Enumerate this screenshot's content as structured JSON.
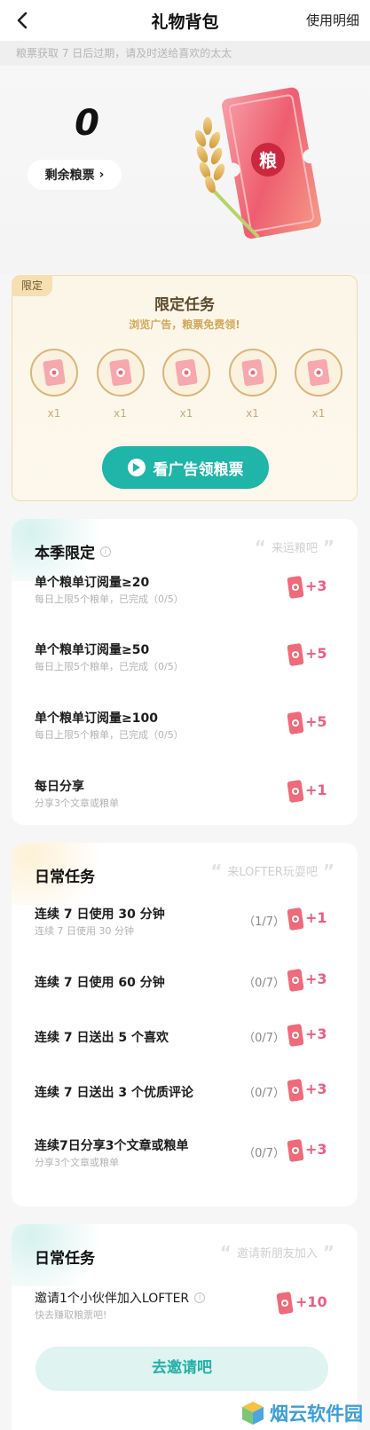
{
  "header": {
    "title": "礼物背包",
    "detail_link": "使用明细"
  },
  "notice": "粮票获取 7 日后过期，请及时送给喜欢的太太",
  "balance": {
    "count": "0",
    "label": "剩余粮票"
  },
  "hero": {
    "ticket_char": "粮"
  },
  "limited": {
    "tag": "限定",
    "title": "限定任务",
    "subtitle": "浏览广告，粮票免费领!",
    "rewards": [
      "x1",
      "x1",
      "x1",
      "x1",
      "x1"
    ],
    "button_label": "看广告领粮票"
  },
  "season": {
    "title": "本季限定",
    "slogan": "来运粮吧",
    "tasks": [
      {
        "title": "单个粮单订阅量≥20",
        "desc": "每日上限5个粮单，已完成（0/5）",
        "reward": "+3"
      },
      {
        "title": "单个粮单订阅量≥50",
        "desc": "每日上限5个粮单，已完成（0/5）",
        "reward": "+5"
      },
      {
        "title": "单个粮单订阅量≥100",
        "desc": "每日上限5个粮单，已完成（0/5）",
        "reward": "+5"
      },
      {
        "title": "每日分享",
        "desc": "分享3个文章或粮单",
        "reward": "+1"
      }
    ]
  },
  "daily": {
    "title": "日常任务",
    "slogan": "来LOFTER玩耍吧",
    "tasks": [
      {
        "title": "连续 7 日使用 30 分钟",
        "desc": "连续 7 日使用 30 分钟",
        "progress": "（1/7）",
        "reward": "+1"
      },
      {
        "title": "连续 7 日使用 60 分钟",
        "desc": "",
        "progress": "（0/7）",
        "reward": "+3"
      },
      {
        "title": "连续 7 日送出 5 个喜欢",
        "desc": "",
        "progress": "（0/7）",
        "reward": "+3"
      },
      {
        "title": "连续 7 日送出 3 个优质评论",
        "desc": "",
        "progress": "（0/7）",
        "reward": "+3"
      },
      {
        "title": "连续7日分享3个文章或粮单",
        "desc": "分享3个文章或粮单",
        "progress": "（0/7）",
        "reward": "+3"
      }
    ]
  },
  "invite": {
    "title": "日常任务",
    "slogan": "邀请新朋友加入",
    "task_title": "邀请1个小伙伴加入LOFTER",
    "task_desc": "快去赚取粮票吧!",
    "reward": "+10",
    "button_label": "去邀请吧"
  },
  "watermark": "烟云软件园",
  "colors": {
    "accent": "#1fb5a9",
    "reward": "#ea5e82",
    "gold": "#d9b67a",
    "ticket": "#ef6a7a"
  }
}
